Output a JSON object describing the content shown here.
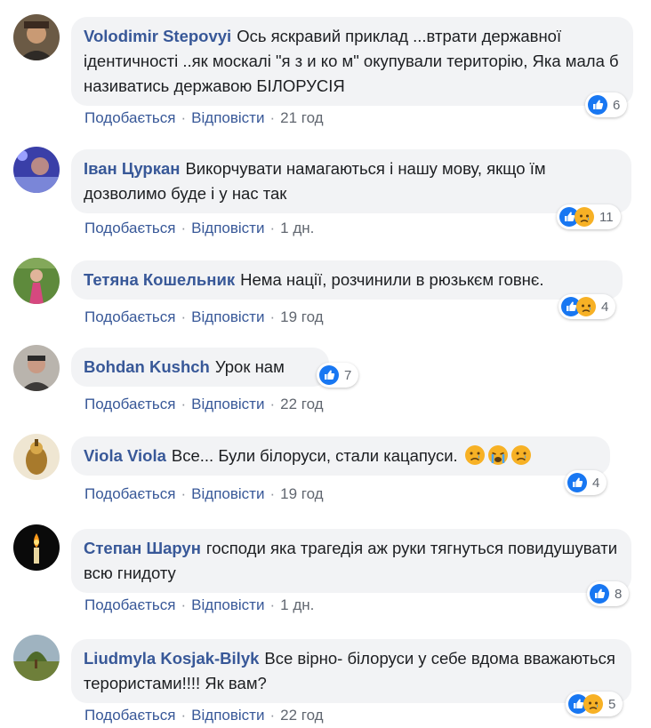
{
  "actions": {
    "like": "Подобається",
    "reply": "Відповісти",
    "separator": "·"
  },
  "colors": {
    "link": "#385898",
    "bubble": "#f2f3f5",
    "like_blue": "#1877f2",
    "sad_yellow": "#f7b125"
  },
  "comments": [
    {
      "author": "Volodimir Stepovyi",
      "text": "Ось яскравий приклад ...втрати державної ідентичності ..як москалі \"я з и ко м\" окупували територію, Яка мала б називатись державою БІЛОРУСІЯ",
      "time": "21 год",
      "reactions": [
        "like"
      ],
      "reaction_count": "6"
    },
    {
      "author": "Іван Цуркан",
      "text": "Викорчувати намагаються і нашу мову, якщо їм дозволимо буде і у нас так",
      "time": "1 дн.",
      "reactions": [
        "like",
        "sad"
      ],
      "reaction_count": "11"
    },
    {
      "author": "Тетяна Кошельник",
      "text": "Нема нації, розчинили в рюзькєм говнє.",
      "time": "19 год",
      "reactions": [
        "like",
        "sad"
      ],
      "reaction_count": "4"
    },
    {
      "author": "Bohdan Kushch",
      "text": "Урок нам",
      "time": "22 год",
      "reactions": [
        "like"
      ],
      "reaction_count": "7"
    },
    {
      "author": "Viola Viola",
      "text": "Все... Були білоруси, стали кацапуси.",
      "emojis": [
        "sad-face",
        "crying-face",
        "sad-face"
      ],
      "time": "19 год",
      "reactions": [
        "like"
      ],
      "reaction_count": "4"
    },
    {
      "author": "Степан Шарун",
      "text": "господи яка трагедія аж руки тягнуться повидушувати всю гнидоту",
      "time": "1 дн.",
      "reactions": [
        "like"
      ],
      "reaction_count": "8"
    },
    {
      "author": "Liudmyla Kosjak-Bilyk",
      "text": "Все вірно- білоруси у себе вдома вважаються терористами!!!! Як вам?",
      "time": "22 год",
      "reactions": [
        "like",
        "sad"
      ],
      "reaction_count": "5"
    }
  ]
}
